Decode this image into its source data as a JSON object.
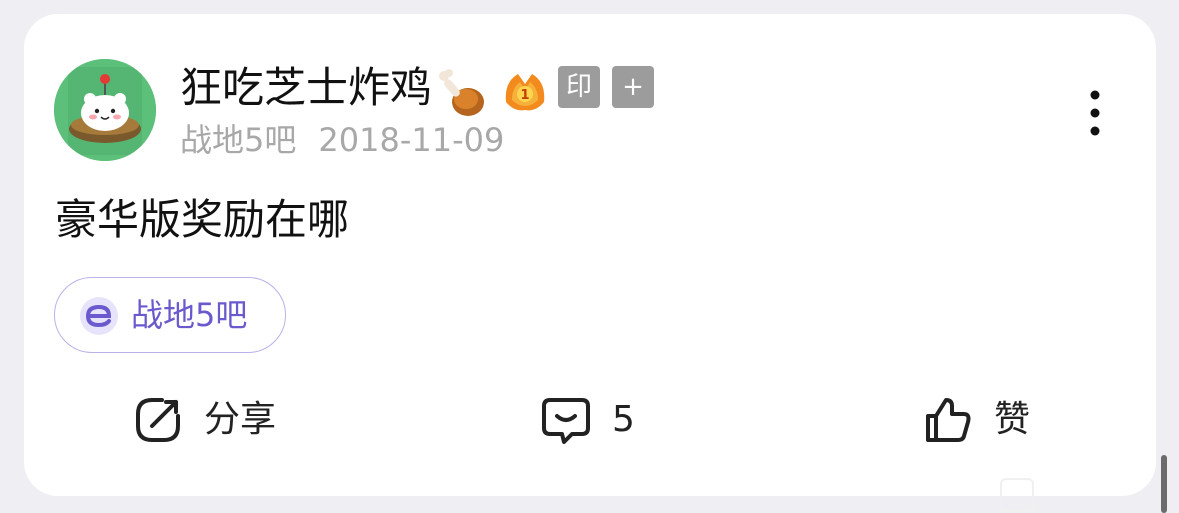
{
  "post": {
    "author": {
      "name": "狂吃芝士炸鸡",
      "avatar_icon": "hamster-avatar-icon",
      "badges": {
        "food_icon": "chicken-drumstick-icon",
        "level_icon": "level-1-flame-badge-icon",
        "seal_label": "印",
        "add_label": "+"
      }
    },
    "forum": "战地5吧",
    "date": "2018-11-09",
    "content": "豪华版奖励在哪",
    "forum_chip": {
      "label": "战地5吧",
      "icon": "forum-e-icon",
      "accent": "#6a5acd"
    },
    "actions": {
      "share_label": "分享",
      "comment_count": "5",
      "like_label": "赞"
    },
    "menu_icon": "more-vertical-icon"
  }
}
